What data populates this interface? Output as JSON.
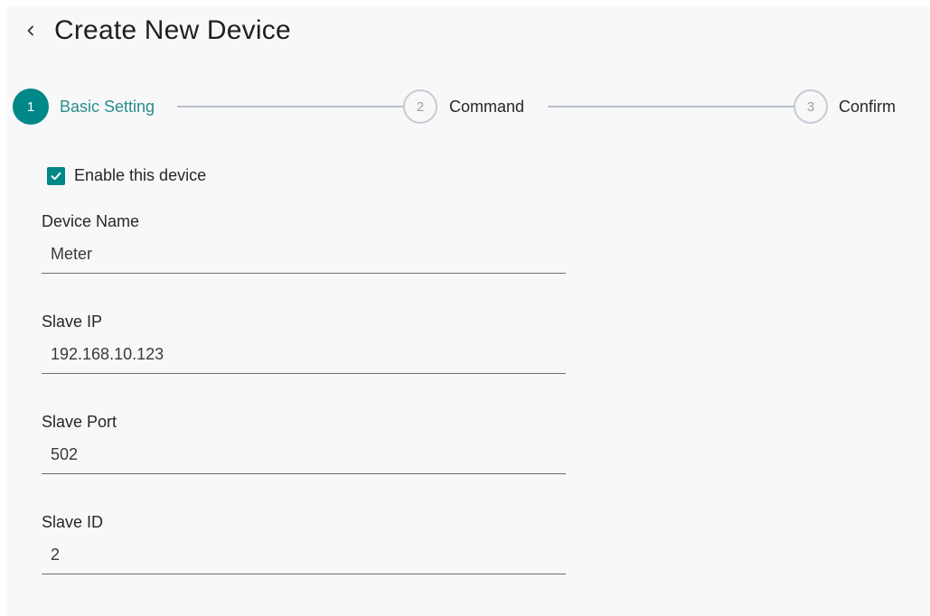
{
  "header": {
    "title": "Create New Device",
    "back_icon": "chevron-left-icon"
  },
  "stepper": {
    "steps": [
      {
        "number": "1",
        "label": "Basic Setting",
        "state": "active"
      },
      {
        "number": "2",
        "label": "Command",
        "state": "inactive"
      },
      {
        "number": "3",
        "label": "Confirm",
        "state": "inactive"
      }
    ]
  },
  "form": {
    "enable": {
      "label": "Enable this device",
      "checked": true
    },
    "device_name": {
      "label": "Device Name",
      "value": "Meter"
    },
    "slave_ip": {
      "label": "Slave IP",
      "value": "192.168.10.123"
    },
    "slave_port": {
      "label": "Slave Port",
      "value": "502"
    },
    "slave_id": {
      "label": "Slave ID",
      "value": "2"
    }
  },
  "colors": {
    "accent": "#008787",
    "accent_text": "#2a8d8c",
    "inactive_border": "#c5cbd6",
    "background": "#f8f8f8"
  }
}
